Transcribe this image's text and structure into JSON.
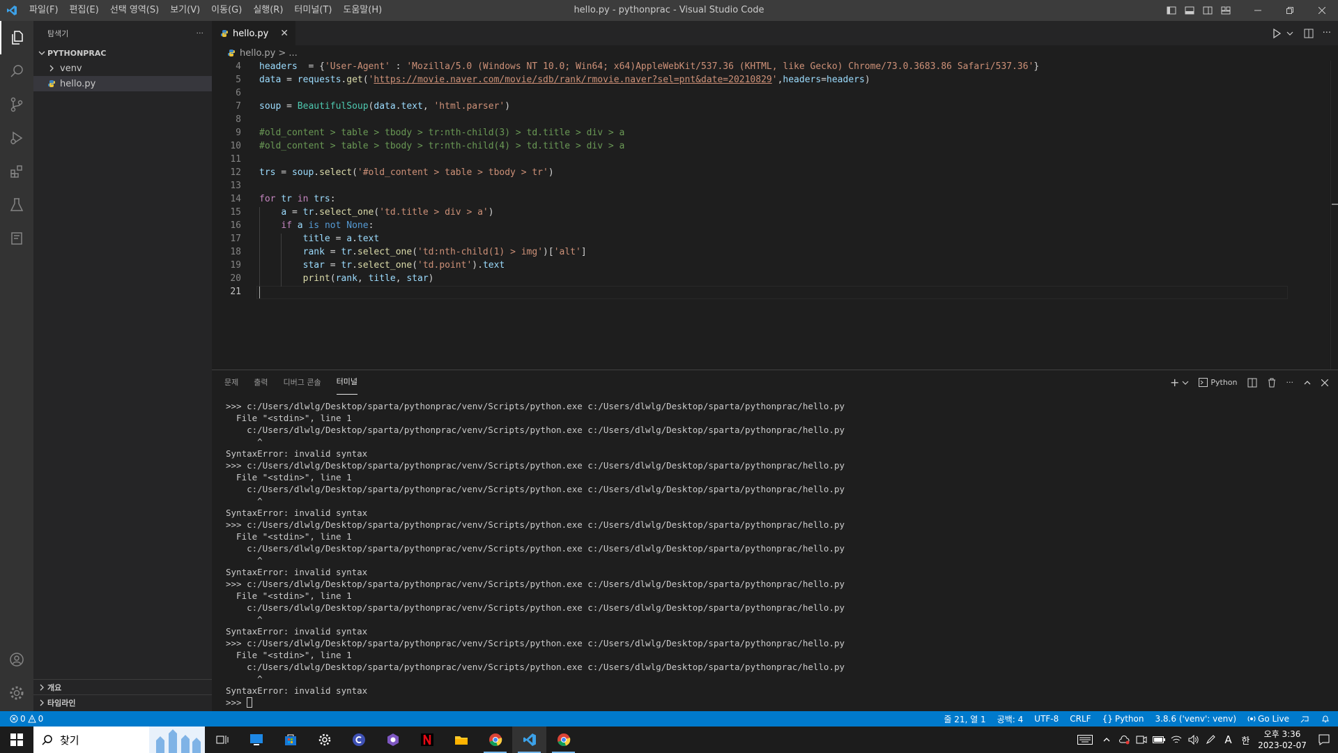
{
  "titlebar": {
    "title": "hello.py - pythonprac - Visual Studio Code",
    "menu": [
      "파일(F)",
      "편집(E)",
      "선택 영역(S)",
      "보기(V)",
      "이동(G)",
      "실행(R)",
      "터미널(T)",
      "도움말(H)"
    ]
  },
  "sidebar": {
    "header": "탐색기",
    "more": "···",
    "folder": "PYTHONPRAC",
    "items": [
      {
        "label": "venv",
        "type": "folder"
      },
      {
        "label": "hello.py",
        "type": "file"
      }
    ],
    "outline": "개요",
    "timeline": "타임라인"
  },
  "editor": {
    "tab_label": "hello.py",
    "breadcrumb": "hello.py > ...",
    "current_line": 21,
    "lines": [
      {
        "n": 4,
        "tokens": [
          [
            "v",
            "headers"
          ],
          [
            "",
            "  = {"
          ],
          [
            "s",
            "'User-Agent'"
          ],
          [
            "",
            " : "
          ],
          [
            "s",
            "'Mozilla/5.0 (Windows NT 10.0; Win64; x64)AppleWebKit/537.36 (KHTML, like Gecko) Chrome/73.0.3683.86 Safari/537.36'"
          ],
          [
            "",
            "}"
          ]
        ]
      },
      {
        "n": 5,
        "tokens": [
          [
            "v",
            "data"
          ],
          [
            "",
            " = "
          ],
          [
            "v",
            "requests"
          ],
          [
            "",
            "."
          ],
          [
            "f",
            "get"
          ],
          [
            "",
            "("
          ],
          [
            "s",
            "'"
          ],
          [
            "u",
            "https://movie.naver.com/movie/sdb/rank/rmovie.naver?sel=pnt&date=20210829"
          ],
          [
            "s",
            "'"
          ],
          [
            "",
            ","
          ],
          [
            "v",
            "headers"
          ],
          [
            "",
            "="
          ],
          [
            "v",
            "headers"
          ],
          [
            "",
            ")"
          ]
        ]
      },
      {
        "n": 6,
        "tokens": []
      },
      {
        "n": 7,
        "tokens": [
          [
            "v",
            "soup"
          ],
          [
            "",
            " = "
          ],
          [
            "cl",
            "BeautifulSoup"
          ],
          [
            "",
            "("
          ],
          [
            "v",
            "data"
          ],
          [
            "",
            "."
          ],
          [
            "v",
            "text"
          ],
          [
            "",
            ", "
          ],
          [
            "s",
            "'html.parser'"
          ],
          [
            "",
            ")"
          ]
        ]
      },
      {
        "n": 8,
        "tokens": []
      },
      {
        "n": 9,
        "tokens": [
          [
            "c",
            "#old_content > table > tbody > tr:nth-child(3) > td.title > div > a"
          ]
        ]
      },
      {
        "n": 10,
        "tokens": [
          [
            "c",
            "#old_content > table > tbody > tr:nth-child(4) > td.title > div > a"
          ]
        ]
      },
      {
        "n": 11,
        "tokens": []
      },
      {
        "n": 12,
        "tokens": [
          [
            "v",
            "trs"
          ],
          [
            "",
            " = "
          ],
          [
            "v",
            "soup"
          ],
          [
            "",
            "."
          ],
          [
            "f",
            "select"
          ],
          [
            "",
            "("
          ],
          [
            "s",
            "'#old_content > table > tbody > tr'"
          ],
          [
            "",
            ")"
          ]
        ]
      },
      {
        "n": 13,
        "tokens": []
      },
      {
        "n": 14,
        "tokens": [
          [
            "k",
            "for"
          ],
          [
            "",
            " "
          ],
          [
            "v",
            "tr"
          ],
          [
            "",
            " "
          ],
          [
            "k",
            "in"
          ],
          [
            "",
            " "
          ],
          [
            "v",
            "trs"
          ],
          [
            "",
            ":"
          ]
        ]
      },
      {
        "n": 15,
        "tokens": [
          [
            "",
            "    "
          ],
          [
            "v",
            "a"
          ],
          [
            "",
            " = "
          ],
          [
            "v",
            "tr"
          ],
          [
            "",
            "."
          ],
          [
            "f",
            "select_one"
          ],
          [
            "",
            "("
          ],
          [
            "s",
            "'td.title > div > a'"
          ],
          [
            "",
            ")"
          ]
        ]
      },
      {
        "n": 16,
        "tokens": [
          [
            "",
            "    "
          ],
          [
            "k",
            "if"
          ],
          [
            "",
            " "
          ],
          [
            "v",
            "a"
          ],
          [
            "",
            " "
          ],
          [
            "kb",
            "is"
          ],
          [
            "",
            " "
          ],
          [
            "kb",
            "not"
          ],
          [
            "",
            " "
          ],
          [
            "kb",
            "None"
          ],
          [
            "",
            ":"
          ]
        ]
      },
      {
        "n": 17,
        "tokens": [
          [
            "",
            "        "
          ],
          [
            "v",
            "title"
          ],
          [
            "",
            " = "
          ],
          [
            "v",
            "a"
          ],
          [
            "",
            "."
          ],
          [
            "v",
            "text"
          ]
        ]
      },
      {
        "n": 18,
        "tokens": [
          [
            "",
            "        "
          ],
          [
            "v",
            "rank"
          ],
          [
            "",
            " = "
          ],
          [
            "v",
            "tr"
          ],
          [
            "",
            "."
          ],
          [
            "f",
            "select_one"
          ],
          [
            "",
            "("
          ],
          [
            "s",
            "'td:nth-child(1) > img'"
          ],
          [
            "",
            ")["
          ],
          [
            "s",
            "'alt'"
          ],
          [
            "",
            "]"
          ]
        ]
      },
      {
        "n": 19,
        "tokens": [
          [
            "",
            "        "
          ],
          [
            "v",
            "star"
          ],
          [
            "",
            " = "
          ],
          [
            "v",
            "tr"
          ],
          [
            "",
            "."
          ],
          [
            "f",
            "select_one"
          ],
          [
            "",
            "("
          ],
          [
            "s",
            "'td.point'"
          ],
          [
            "",
            ")."
          ],
          [
            "v",
            "text"
          ]
        ]
      },
      {
        "n": 20,
        "tokens": [
          [
            "",
            "        "
          ],
          [
            "f",
            "print"
          ],
          [
            "",
            "("
          ],
          [
            "v",
            "rank"
          ],
          [
            "",
            ", "
          ],
          [
            "v",
            "title"
          ],
          [
            "",
            ", "
          ],
          [
            "v",
            "star"
          ],
          [
            "",
            ")"
          ]
        ]
      },
      {
        "n": 21,
        "tokens": []
      }
    ]
  },
  "panel": {
    "tabs": [
      "문제",
      "출력",
      "디버그 콘솔",
      "터미널"
    ],
    "active_tab": "터미널",
    "shell_label": "Python",
    "terminal_lines": [
      ">>> c:/Users/dlwlg/Desktop/sparta/pythonprac/venv/Scripts/python.exe c:/Users/dlwlg/Desktop/sparta/pythonprac/hello.py",
      "  File \"<stdin>\", line 1",
      "    c:/Users/dlwlg/Desktop/sparta/pythonprac/venv/Scripts/python.exe c:/Users/dlwlg/Desktop/sparta/pythonprac/hello.py",
      "      ^",
      "SyntaxError: invalid syntax",
      ">>> c:/Users/dlwlg/Desktop/sparta/pythonprac/venv/Scripts/python.exe c:/Users/dlwlg/Desktop/sparta/pythonprac/hello.py",
      "  File \"<stdin>\", line 1",
      "    c:/Users/dlwlg/Desktop/sparta/pythonprac/venv/Scripts/python.exe c:/Users/dlwlg/Desktop/sparta/pythonprac/hello.py",
      "      ^",
      "SyntaxError: invalid syntax",
      ">>> c:/Users/dlwlg/Desktop/sparta/pythonprac/venv/Scripts/python.exe c:/Users/dlwlg/Desktop/sparta/pythonprac/hello.py",
      "  File \"<stdin>\", line 1",
      "    c:/Users/dlwlg/Desktop/sparta/pythonprac/venv/Scripts/python.exe c:/Users/dlwlg/Desktop/sparta/pythonprac/hello.py",
      "      ^",
      "SyntaxError: invalid syntax",
      ">>> c:/Users/dlwlg/Desktop/sparta/pythonprac/venv/Scripts/python.exe c:/Users/dlwlg/Desktop/sparta/pythonprac/hello.py",
      "  File \"<stdin>\", line 1",
      "    c:/Users/dlwlg/Desktop/sparta/pythonprac/venv/Scripts/python.exe c:/Users/dlwlg/Desktop/sparta/pythonprac/hello.py",
      "      ^",
      "SyntaxError: invalid syntax",
      ">>> c:/Users/dlwlg/Desktop/sparta/pythonprac/venv/Scripts/python.exe c:/Users/dlwlg/Desktop/sparta/pythonprac/hello.py",
      "  File \"<stdin>\", line 1",
      "    c:/Users/dlwlg/Desktop/sparta/pythonprac/venv/Scripts/python.exe c:/Users/dlwlg/Desktop/sparta/pythonprac/hello.py",
      "      ^",
      "SyntaxError: invalid syntax"
    ],
    "prompt": ">>> "
  },
  "statusbar": {
    "errors": "0",
    "warnings": "0",
    "position": "줄 21, 열 1",
    "spaces": "공백: 4",
    "encoding": "UTF-8",
    "eol": "CRLF",
    "language": "Python",
    "interpreter": "3.8.6 ('venv': venv)",
    "golive": "Go Live"
  },
  "taskbar": {
    "search_placeholder": "찾기",
    "time": "오후 3:36",
    "date": "2023-02-07",
    "ime_mode": "A",
    "ime_lang": "한"
  },
  "colors": {
    "accent": "#007acc",
    "editor_bg": "#1e1e1e",
    "sidebar_bg": "#252526",
    "activity_bg": "#333333",
    "titlebar_bg": "#3c3c3c"
  }
}
